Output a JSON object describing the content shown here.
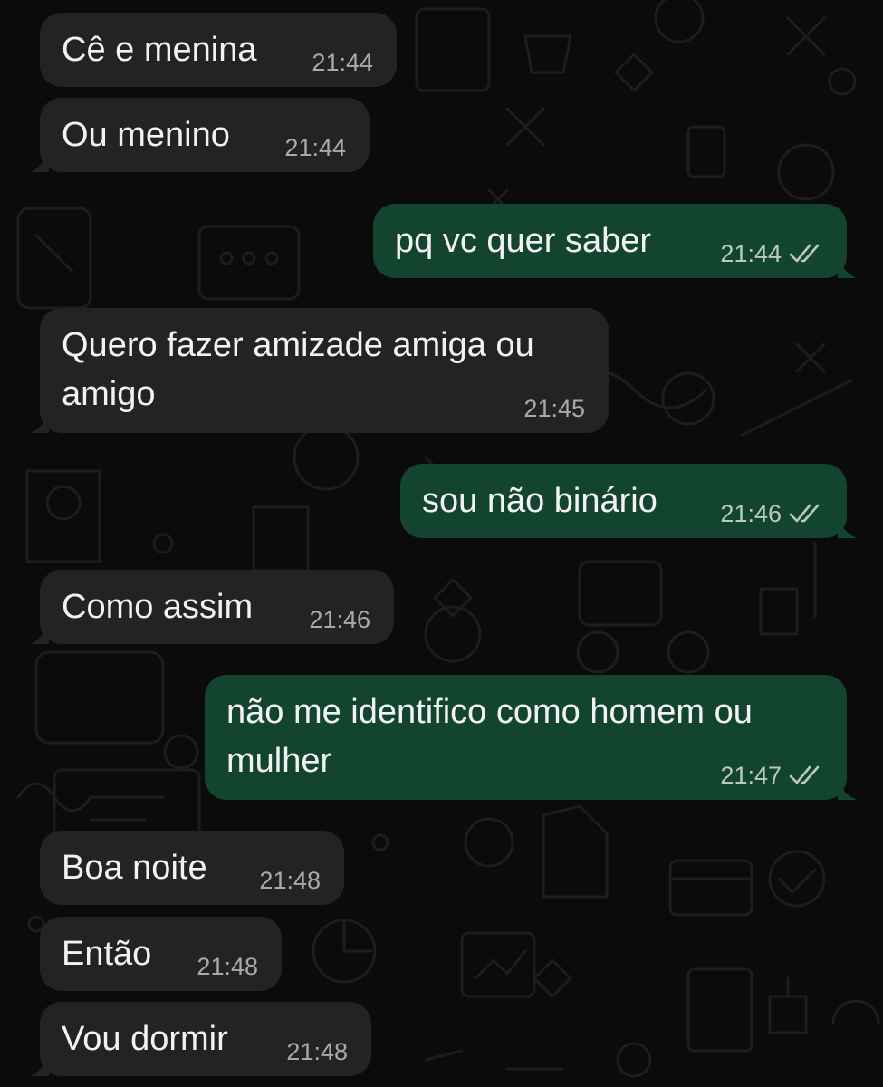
{
  "colors": {
    "background": "#0b0b0b",
    "incoming_bubble": "#232323",
    "outgoing_bubble": "#13442f",
    "text": "#f2f2f2",
    "timestamp": "#a9a9a9"
  },
  "messages": [
    {
      "id": "m1",
      "direction": "incoming",
      "text": "Cê e menina",
      "time": "21:44"
    },
    {
      "id": "m2",
      "direction": "incoming",
      "text": "Ou menino",
      "time": "21:44"
    },
    {
      "id": "m3",
      "direction": "outgoing",
      "text": "pq vc quer saber",
      "time": "21:44",
      "status": "read"
    },
    {
      "id": "m4",
      "direction": "incoming",
      "text": "Quero fazer amizade amiga ou\namigo",
      "time": "21:45"
    },
    {
      "id": "m5",
      "direction": "outgoing",
      "text": "sou não binário",
      "time": "21:46",
      "status": "read"
    },
    {
      "id": "m6",
      "direction": "incoming",
      "text": "Como assim",
      "time": "21:46"
    },
    {
      "id": "m7",
      "direction": "outgoing",
      "text": "não me identifico como homem ou\nmulher",
      "time": "21:47",
      "status": "read"
    },
    {
      "id": "m8",
      "direction": "incoming",
      "text": "Boa noite",
      "time": "21:48"
    },
    {
      "id": "m9",
      "direction": "incoming",
      "text": "Então",
      "time": "21:48"
    },
    {
      "id": "m10",
      "direction": "incoming",
      "text": "Vou dormir",
      "time": "21:48"
    }
  ]
}
